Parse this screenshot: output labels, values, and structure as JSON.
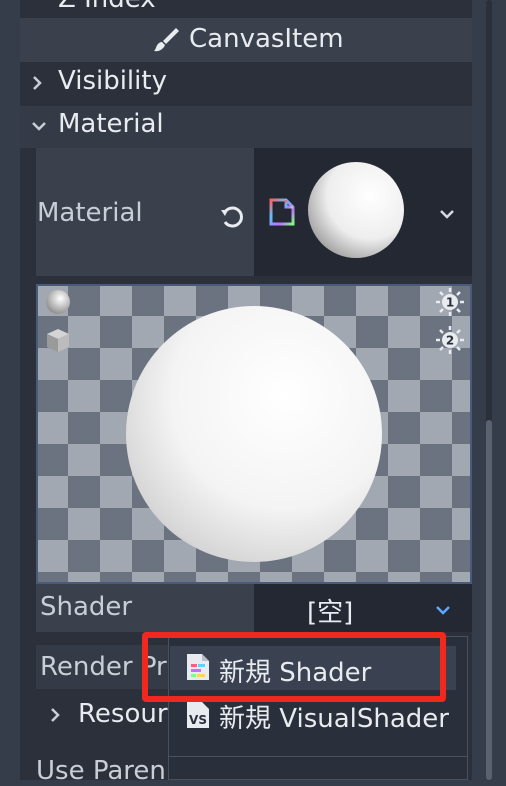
{
  "header": {
    "top_partial_label": "Z Index",
    "canvas_item_label": "CanvasItem"
  },
  "sections": {
    "visibility_label": "Visibility",
    "material_label": "Material"
  },
  "material_property": {
    "label": "Material"
  },
  "shader_property": {
    "label": "Shader",
    "value": "[空]"
  },
  "render_priority": {
    "label": "Render Pr"
  },
  "resource_label": "Resour",
  "use_parent_label": "Use Paren",
  "popup_menu": {
    "items": [
      {
        "label": "新規 Shader"
      },
      {
        "label": "新規 VisualShader"
      }
    ]
  },
  "colors": {
    "highlight_box": "#f0281e",
    "panel_bg": "#2b303b"
  },
  "icons": [
    "brush-icon",
    "chevron-right-icon",
    "chevron-down-icon",
    "reset-icon",
    "material-resource-icon",
    "sphere-preview-icon",
    "box-preview-icon",
    "light1-toggle-icon",
    "light2-toggle-icon",
    "shader-file-icon",
    "visual-shader-icon"
  ]
}
